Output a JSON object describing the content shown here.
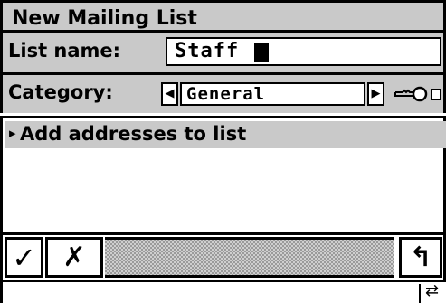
{
  "window": {
    "title": "New Mailing List"
  },
  "list_name": {
    "label": "List name:",
    "value": "Staff"
  },
  "category": {
    "label": "Category:",
    "value": "General",
    "prev_glyph": "◀",
    "next_glyph": "▶"
  },
  "actions": {
    "add_addresses_label": "Add addresses to list",
    "bullet_glyph": "▸"
  },
  "toolbar": {
    "ok_glyph": "✓",
    "cancel_glyph": "✗",
    "back_glyph": "↰",
    "swap_glyph": "⇄"
  },
  "icons": {
    "key": "key-icon",
    "checkmark": "checkmark-icon",
    "cancel": "cancel-icon",
    "back": "back-arrow-icon",
    "swap": "swap-arrows-icon"
  },
  "colors": {
    "panel_gray": "#c9c9c9",
    "border": "#000000",
    "background": "#ffffff"
  }
}
